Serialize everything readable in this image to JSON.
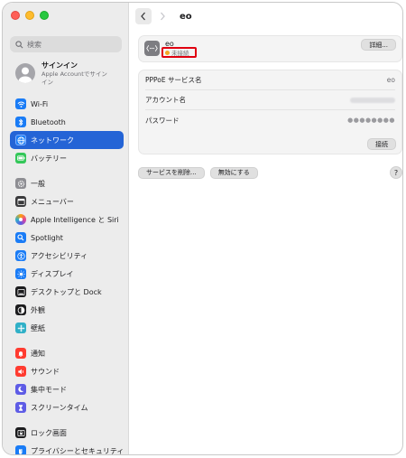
{
  "sidebar": {
    "search_placeholder": "検索",
    "account": {
      "title": "サインイン",
      "subtitle_line1": "Apple Accountでサイン",
      "subtitle_line2": "イン"
    },
    "items": [
      {
        "label": "Wi-Fi",
        "icon": "wifi-icon",
        "color": "#1a7cf6"
      },
      {
        "label": "Bluetooth",
        "icon": "bluetooth-icon",
        "color": "#1a7cf6"
      },
      {
        "label": "ネットワーク",
        "icon": "globe-icon",
        "color": "#1a7cf6"
      },
      {
        "label": "バッテリー",
        "icon": "battery-icon",
        "color": "#34c759"
      },
      {
        "label": "一般",
        "icon": "gear-icon",
        "color": "#8e8e93"
      },
      {
        "label": "メニューバー",
        "icon": "menubar-icon",
        "color": "#3a3a3c"
      },
      {
        "label": "Apple Intelligence と Siri",
        "icon": "siri-icon",
        "color": "#e4439a"
      },
      {
        "label": "Spotlight",
        "icon": "spotlight-icon",
        "color": "#1a7cf6"
      },
      {
        "label": "アクセシビリティ",
        "icon": "accessibility-icon",
        "color": "#1a7cf6"
      },
      {
        "label": "ディスプレイ",
        "icon": "display-icon",
        "color": "#1a7cf6"
      },
      {
        "label": "デスクトップと Dock",
        "icon": "dock-icon",
        "color": "#1c1c1e"
      },
      {
        "label": "外観",
        "icon": "appearance-icon",
        "color": "#1c1c1e"
      },
      {
        "label": "壁紙",
        "icon": "wallpaper-icon",
        "color": "#30b0c7"
      },
      {
        "label": "通知",
        "icon": "notification-icon",
        "color": "#ff3b30"
      },
      {
        "label": "サウンド",
        "icon": "sound-icon",
        "color": "#ff3b30"
      },
      {
        "label": "集中モード",
        "icon": "focus-icon",
        "color": "#5e5ce6"
      },
      {
        "label": "スクリーンタイム",
        "icon": "screentime-icon",
        "color": "#5e5ce6"
      },
      {
        "label": "ロック画面",
        "icon": "lock-screen-icon",
        "color": "#1c1c1e"
      },
      {
        "label": "プライバシーとセキュリティ",
        "icon": "privacy-icon",
        "color": "#1a7cf6"
      }
    ],
    "active": "ネットワーク"
  },
  "main": {
    "title": "eo",
    "service": {
      "name": "eo",
      "status": "未接続",
      "details_label": "詳細..."
    },
    "rows": [
      {
        "label": "PPPoE サービス名",
        "value": "eo"
      },
      {
        "label": "アカウント名",
        "value": ""
      },
      {
        "label": "パスワード",
        "value": "●●●●●●●●"
      }
    ],
    "connect_label": "接続",
    "delete_label": "サービスを削除...",
    "disable_label": "無効にする",
    "help_label": "?"
  }
}
